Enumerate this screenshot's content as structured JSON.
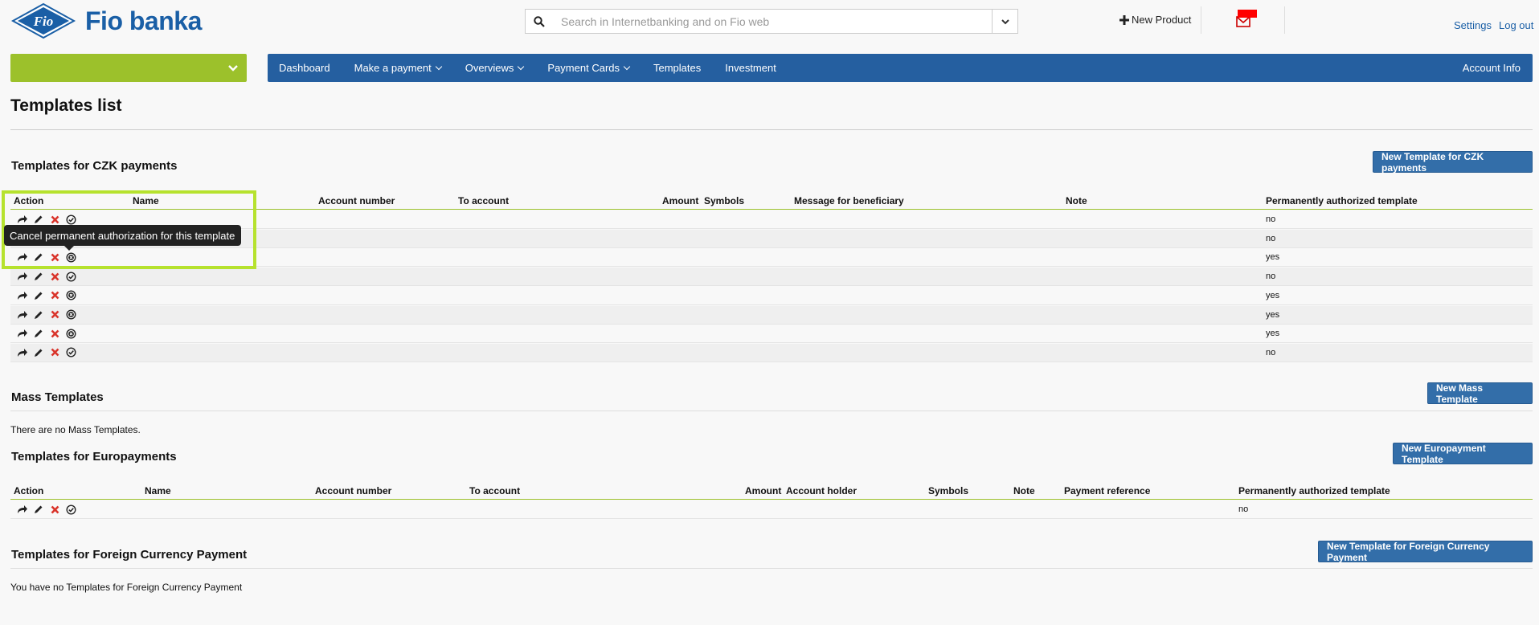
{
  "header": {
    "logo_text": "Fio banka",
    "logo_mark": "Fio",
    "search_placeholder": "Search in Internetbanking and on Fio web",
    "new_product": "New Product",
    "settings": "Settings",
    "logout": "Log out"
  },
  "nav": {
    "items": [
      "Dashboard",
      "Make a payment",
      "Overviews",
      "Payment Cards",
      "Templates",
      "Investment"
    ],
    "right": "Account Info"
  },
  "page_title": "Templates list",
  "czk": {
    "title": "Templates for CZK payments",
    "new_button": "New Template for CZK payments",
    "columns": [
      "Action",
      "Name",
      "Account number",
      "To account",
      "Amount",
      "Symbols",
      "Message for beneficiary",
      "Note",
      "Permanently authorized template"
    ],
    "rows": [
      {
        "authorized": "no"
      },
      {
        "authorized": "no"
      },
      {
        "authorized": "yes"
      },
      {
        "authorized": "no"
      },
      {
        "authorized": "yes"
      },
      {
        "authorized": "yes"
      },
      {
        "authorized": "yes"
      },
      {
        "authorized": "no"
      }
    ],
    "tooltip": "Cancel permanent authorization for this template"
  },
  "mass": {
    "title": "Mass Templates",
    "new_button": "New Mass Template",
    "empty": "There are no Mass Templates."
  },
  "euro": {
    "title": "Templates for Europayments",
    "new_button": "New Europayment Template",
    "columns": [
      "Action",
      "Name",
      "Account number",
      "To account",
      "Amount",
      "Account holder",
      "Symbols",
      "Note",
      "Payment reference",
      "Permanently authorized template"
    ],
    "rows": [
      {
        "authorized": "no"
      }
    ]
  },
  "foreign": {
    "title": "Templates for Foreign Currency Payment",
    "new_button": "New Template for Foreign Currency Payment",
    "empty": "You have no Templates for Foreign Currency Payment"
  },
  "colors": {
    "brand_blue": "#255fa0",
    "accent_green": "#9cc12b",
    "highlight": "#b6e22e",
    "mail_badge": "#ff0000"
  },
  "icons": {
    "use": "share-arrow-icon",
    "edit": "pencil-icon",
    "delete": "x-icon",
    "authorize": "check-circle-icon",
    "deauthorize": "x-circle-icon"
  }
}
